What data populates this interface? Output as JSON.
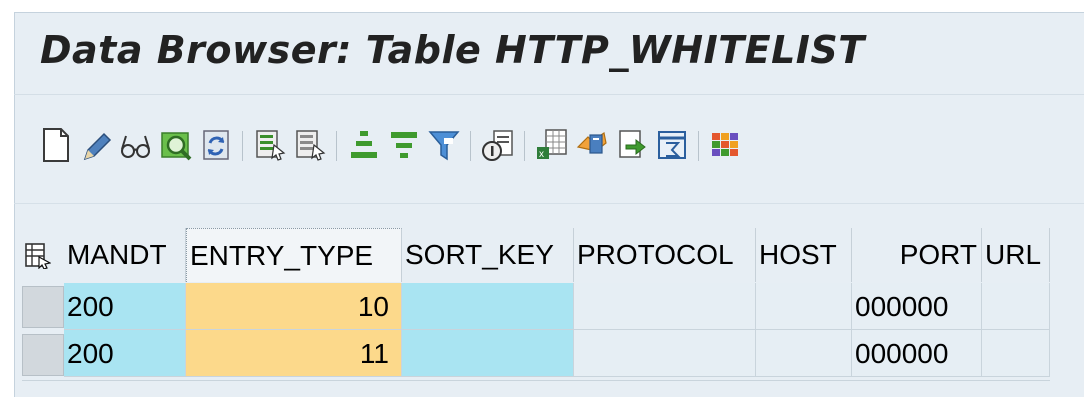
{
  "window": {
    "title": "Data Browser: Table HTTP_WHITELIST"
  },
  "toolbar": {
    "buttons": [
      {
        "name": "create-entry-icon"
      },
      {
        "name": "change-pencil-icon"
      },
      {
        "name": "display-glasses-icon"
      },
      {
        "name": "check-table-icon"
      },
      {
        "name": "refresh-icon"
      },
      {
        "name": "select-all-icon"
      },
      {
        "name": "deselect-all-icon"
      },
      {
        "name": "sort-ascending-icon"
      },
      {
        "name": "sort-descending-icon"
      },
      {
        "name": "filter-icon"
      },
      {
        "name": "details-icon"
      },
      {
        "name": "export-spreadsheet-icon"
      },
      {
        "name": "print-icon"
      },
      {
        "name": "upload-icon"
      },
      {
        "name": "abc-analysis-icon"
      },
      {
        "name": "layout-grid-icon"
      }
    ]
  },
  "table": {
    "columns": [
      {
        "key": "MANDT",
        "label": "MANDT"
      },
      {
        "key": "ENTRY_TYPE",
        "label": "ENTRY_TYPE"
      },
      {
        "key": "SORT_KEY",
        "label": "SORT_KEY"
      },
      {
        "key": "PROTOCOL",
        "label": "PROTOCOL"
      },
      {
        "key": "HOST",
        "label": "HOST"
      },
      {
        "key": "PORT",
        "label": "PORT"
      },
      {
        "key": "URL",
        "label": "URL"
      }
    ],
    "rows": [
      {
        "MANDT": "200",
        "ENTRY_TYPE": "10",
        "SORT_KEY": "",
        "PROTOCOL": "",
        "HOST": "",
        "PORT": "000000",
        "URL": ""
      },
      {
        "MANDT": "200",
        "ENTRY_TYPE": "11",
        "SORT_KEY": "",
        "PROTOCOL": "",
        "HOST": "",
        "PORT": "000000",
        "URL": ""
      }
    ]
  },
  "colors": {
    "key_column": "#a9e4f2",
    "selected_column": "#fcd98b",
    "data_cell": "#e6eef4",
    "header_bg": "#e7eef4"
  }
}
